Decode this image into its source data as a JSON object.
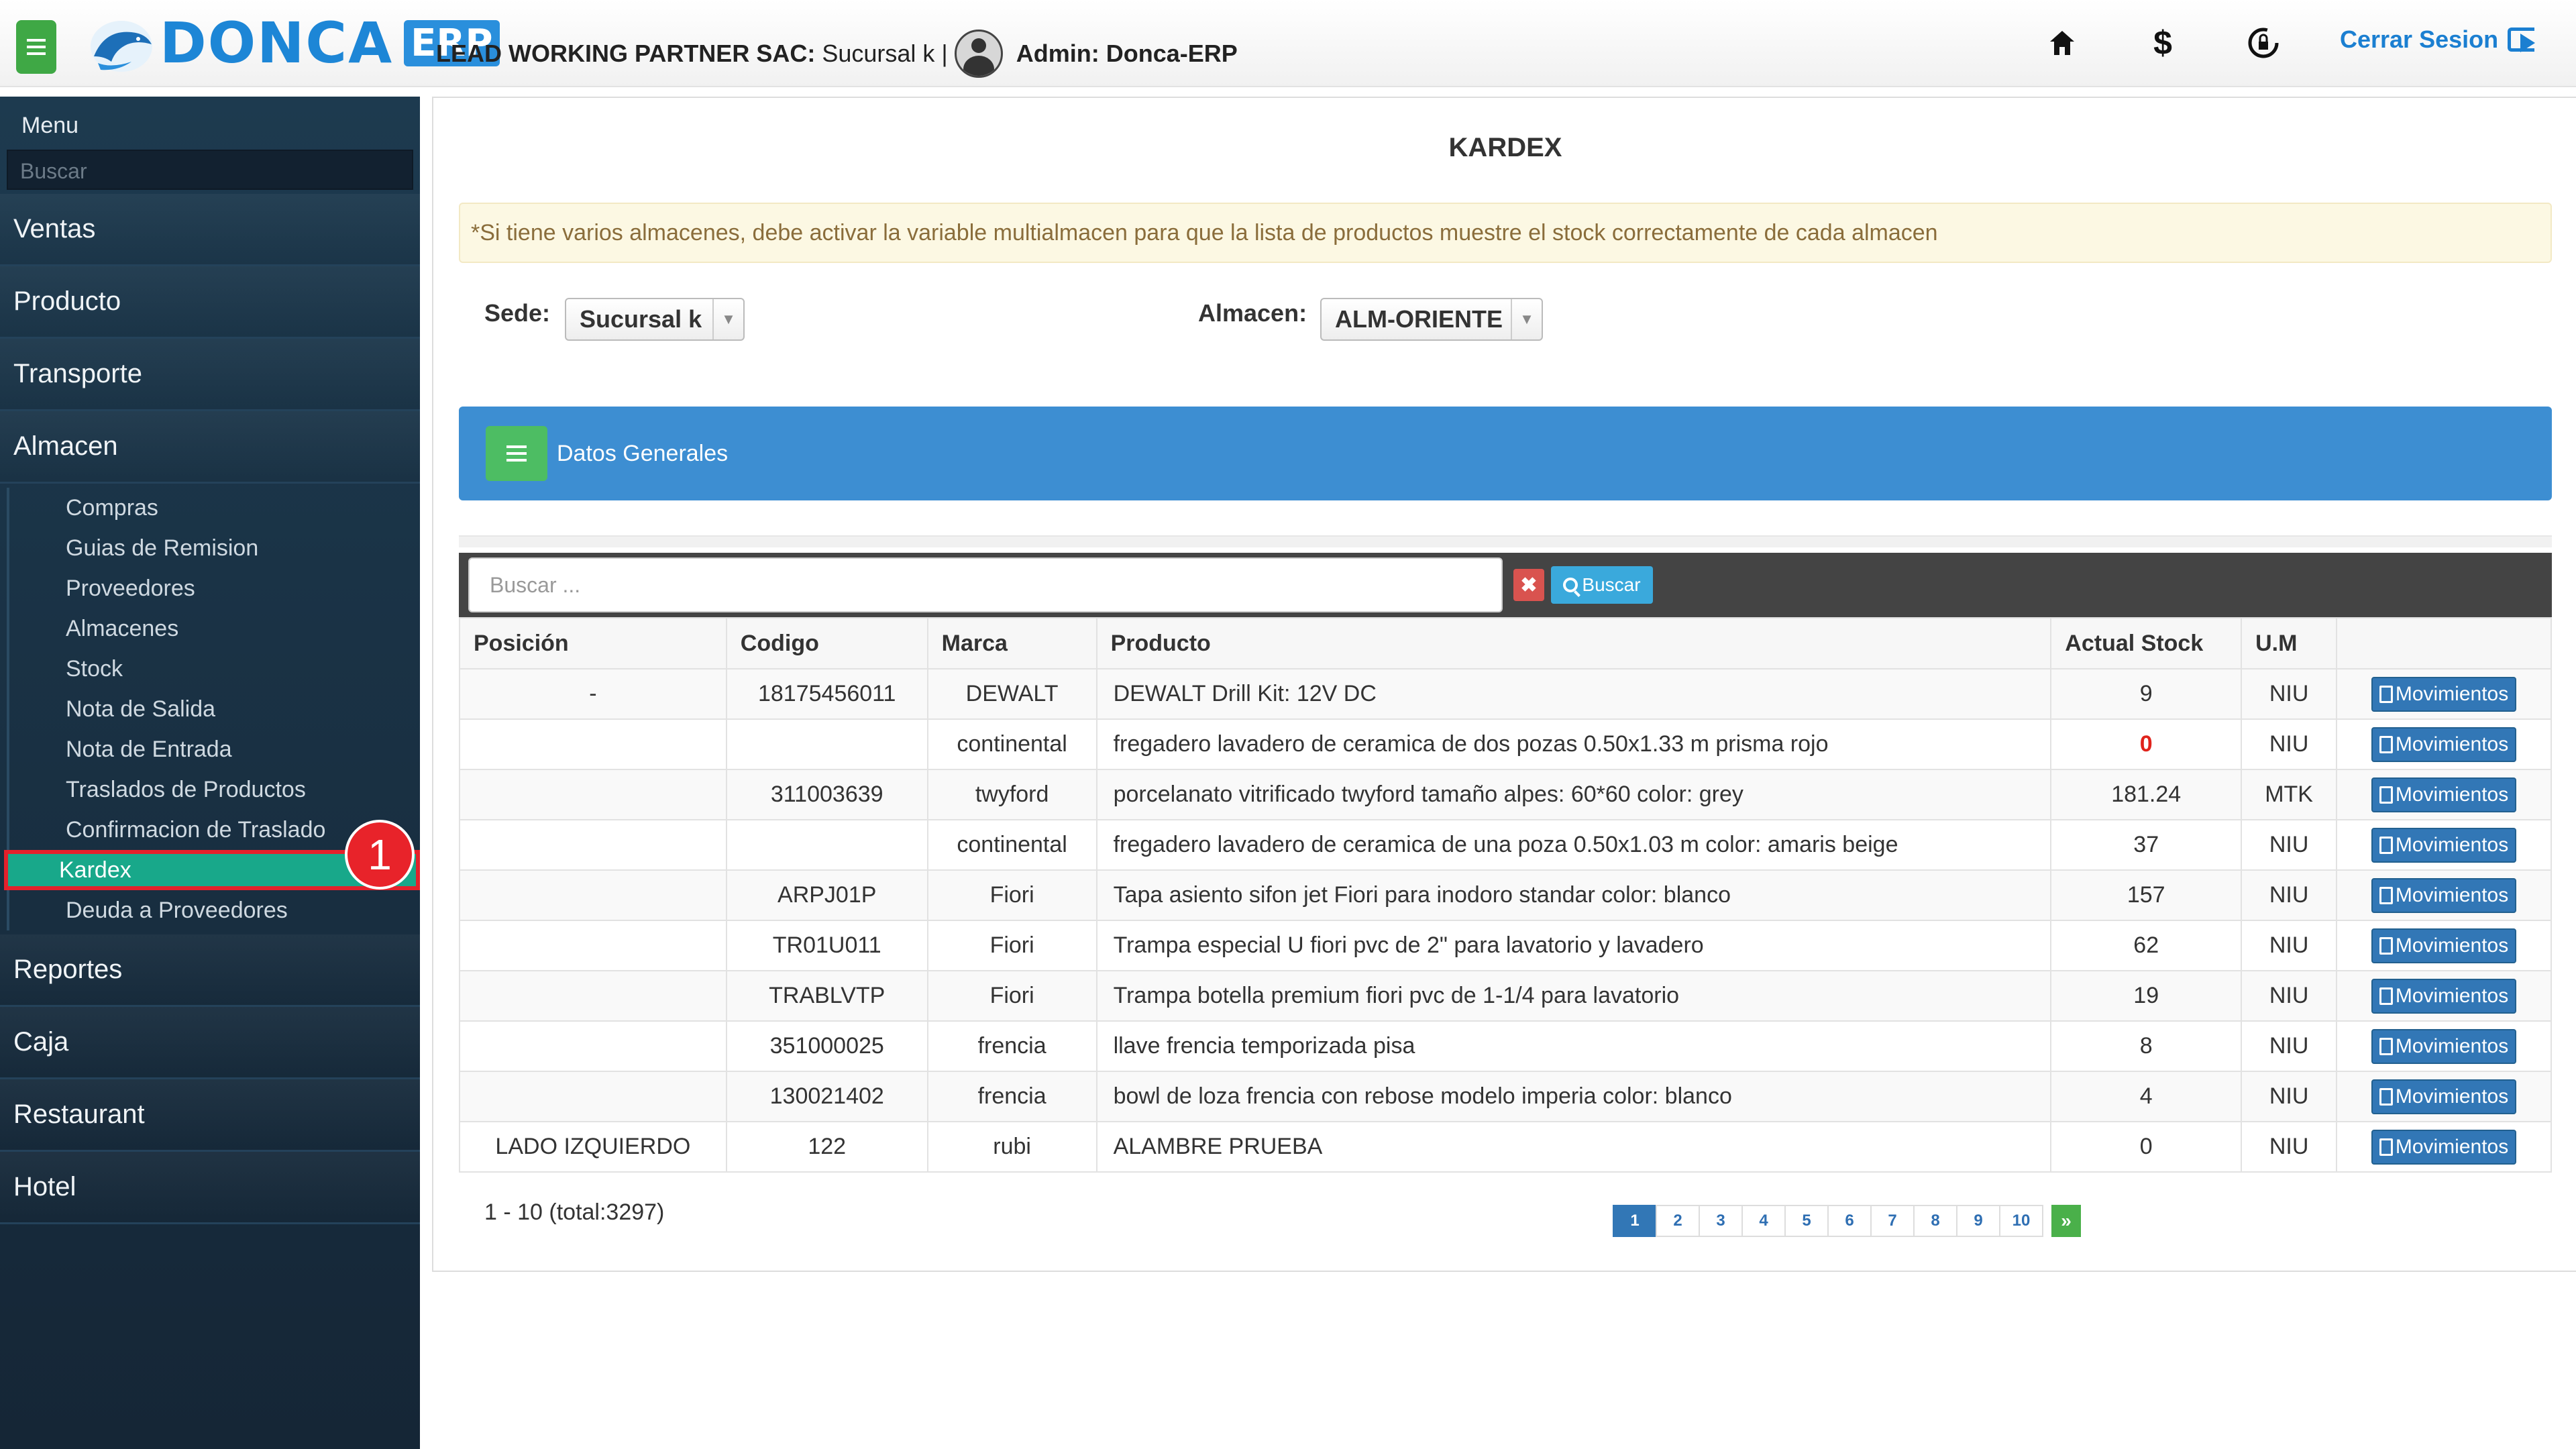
{
  "header": {
    "brand": "DONCA",
    "brand_suffix": "ERP",
    "company": "LEAD WORKING PARTNER SAC:",
    "branch": "Sucursal k |",
    "admin": "Admin: Donca-ERP",
    "icons": [
      "home-icon",
      "dollar-icon",
      "lock-refresh-icon"
    ],
    "logout": "Cerrar Sesion"
  },
  "sidebar": {
    "title": "Menu",
    "search_placeholder": "Buscar",
    "sections_top": [
      "Ventas",
      "Producto",
      "Transporte",
      "Almacen"
    ],
    "almacen_items": [
      "Compras",
      "Guias de Remision",
      "Proveedores",
      "Almacenes",
      "Stock",
      "Nota de Salida",
      "Nota de Entrada",
      "Traslados de Productos",
      "Confirmacion de Traslado",
      "Kardex",
      "Deuda a Proveedores"
    ],
    "active_item": "Kardex",
    "sections_bottom": [
      "Reportes",
      "Caja",
      "Restaurant",
      "Hotel"
    ],
    "badge": "1"
  },
  "main": {
    "title": "KARDEX",
    "notice": "*Si tiene varios almacenes, debe activar la variable multialmacen para que la lista de productos muestre el stock correctamente de cada almacen",
    "sede_label": "Sede:",
    "sede_value": "Sucursal k",
    "almacen_label": "Almacen:",
    "almacen_value": "ALM-ORIENTE",
    "panel_title": "Datos Generales",
    "search_placeholder": "Buscar ...",
    "search_button": "Buscar",
    "columns": [
      "Posición",
      "Codigo",
      "Marca",
      "Producto",
      "Actual Stock",
      "U.M",
      ""
    ],
    "rows": [
      {
        "posicion": "-",
        "codigo": "18175456011",
        "marca": "DEWALT",
        "producto": "DEWALT Drill Kit: 12V DC",
        "stock": "9",
        "um": "NIU",
        "action": "Movimientos"
      },
      {
        "posicion": "",
        "codigo": "",
        "marca": "continental",
        "producto": "fregadero lavadero de ceramica de dos pozas 0.50x1.33 m prisma rojo",
        "stock": "0",
        "um": "NIU",
        "action": "Movimientos"
      },
      {
        "posicion": "",
        "codigo": "311003639",
        "marca": "twyford",
        "producto": "porcelanato vitrificado twyford tamaño alpes: 60*60 color: grey",
        "stock": "181.24",
        "um": "MTK",
        "action": "Movimientos"
      },
      {
        "posicion": "",
        "codigo": "",
        "marca": "continental",
        "producto": "fregadero lavadero de ceramica de una poza 0.50x1.03 m color: amaris beige",
        "stock": "37",
        "um": "NIU",
        "action": "Movimientos"
      },
      {
        "posicion": "",
        "codigo": "ARPJ01P",
        "marca": "Fiori",
        "producto": "Tapa asiento sifon jet Fiori para inodoro standar color: blanco",
        "stock": "157",
        "um": "NIU",
        "action": "Movimientos"
      },
      {
        "posicion": "",
        "codigo": "TR01U011",
        "marca": "Fiori",
        "producto": "Trampa especial U fiori pvc de 2\" para lavatorio y lavadero",
        "stock": "62",
        "um": "NIU",
        "action": "Movimientos"
      },
      {
        "posicion": "",
        "codigo": "TRABLVTP",
        "marca": "Fiori",
        "producto": "Trampa botella premium fiori pvc de 1-1/4 para lavatorio",
        "stock": "19",
        "um": "NIU",
        "action": "Movimientos"
      },
      {
        "posicion": "",
        "codigo": "351000025",
        "marca": "frencia",
        "producto": "llave frencia temporizada pisa",
        "stock": "8",
        "um": "NIU",
        "action": "Movimientos"
      },
      {
        "posicion": "",
        "codigo": "130021402",
        "marca": "frencia",
        "producto": "bowl de loza frencia con rebose modelo imperia color: blanco",
        "stock": "4",
        "um": "NIU",
        "action": "Movimientos"
      },
      {
        "posicion": "LADO IZQUIERDO",
        "codigo": "122",
        "marca": "rubi",
        "producto": "ALAMBRE PRUEBA",
        "stock": "0",
        "um": "NIU",
        "action": "Movimientos"
      }
    ],
    "range_text": "1 - 10 (total:3297)",
    "pages": [
      "1",
      "2",
      "3",
      "4",
      "5",
      "6",
      "7",
      "8",
      "9",
      "10"
    ],
    "next_label": "»"
  },
  "colors": {
    "accent_green": "#3fa845",
    "panel_blue": "#3d8ed2",
    "active_teal": "#18a88a",
    "highlight_red": "#e4212b"
  }
}
